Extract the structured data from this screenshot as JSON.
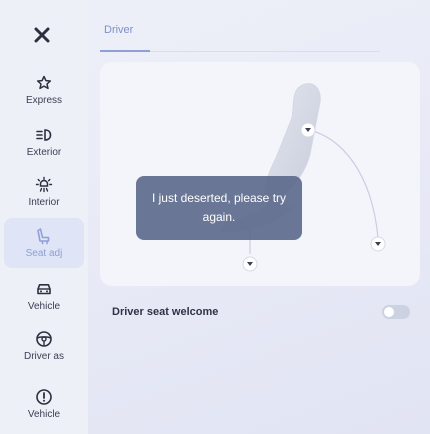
{
  "sidebar": {
    "close_icon": "close-icon",
    "items": [
      {
        "label": "Express",
        "icon": "star-icon"
      },
      {
        "label": "Exterior",
        "icon": "headlight-icon"
      },
      {
        "label": "Interior",
        "icon": "interior-light-icon"
      },
      {
        "label": "Seat adj",
        "icon": "seat-icon",
        "active": true
      },
      {
        "label": "Vehicle",
        "icon": "car-icon"
      },
      {
        "label": "Driver as",
        "icon": "steering-wheel-icon"
      },
      {
        "label": "Vehicle",
        "icon": "info-icon"
      }
    ]
  },
  "tabs": [
    {
      "label": "Driver",
      "active": true
    }
  ],
  "toast": {
    "message": "I just deserted, please try again."
  },
  "settings": {
    "driver_seat_welcome_label": "Driver seat welcome",
    "driver_seat_welcome_enabled": false
  },
  "colors": {
    "accent": "#8ea0d6",
    "toast_bg": "#5d6a8c",
    "panel_bg": "#f4f5fb"
  }
}
